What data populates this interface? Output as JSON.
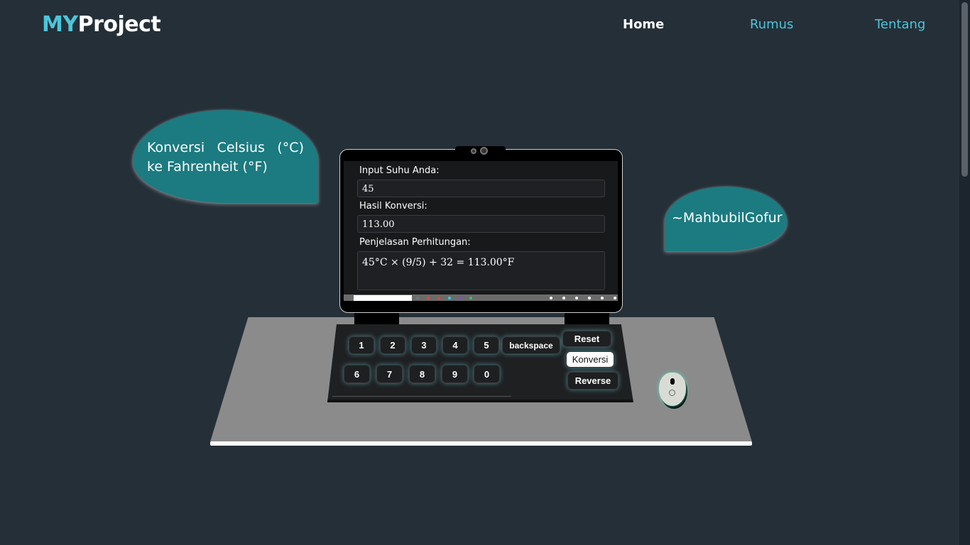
{
  "nav": {
    "brand_accent": "MY",
    "brand_rest": "Project",
    "links": [
      "Home",
      "Rumus",
      "Tentang"
    ]
  },
  "bubbles": {
    "title": "Konversi Celsius (°C) ke Fahrenheit (°F)",
    "author": "~MahbubilGofur"
  },
  "form": {
    "input_label": "Input Suhu Anda:",
    "input_value": "45",
    "result_label": "Hasil Konversi:",
    "result_value": "113.00",
    "explain_label": "Penjelasan Perhitungan:",
    "explain_value": "45°C × (9/5) + 32 = 113.00°F"
  },
  "keys": {
    "digits_row1": [
      "1",
      "2",
      "3",
      "4",
      "5"
    ],
    "digits_row2": [
      "6",
      "7",
      "8",
      "9",
      "0"
    ],
    "backspace": "backspace",
    "reset": "Reset",
    "konversi": "Konversi",
    "reverse": "Reverse"
  },
  "colors": {
    "accent": "#4cc5da",
    "background": "#252f38",
    "bubble": "#1b7b80",
    "desk": "#8b8b8b"
  }
}
